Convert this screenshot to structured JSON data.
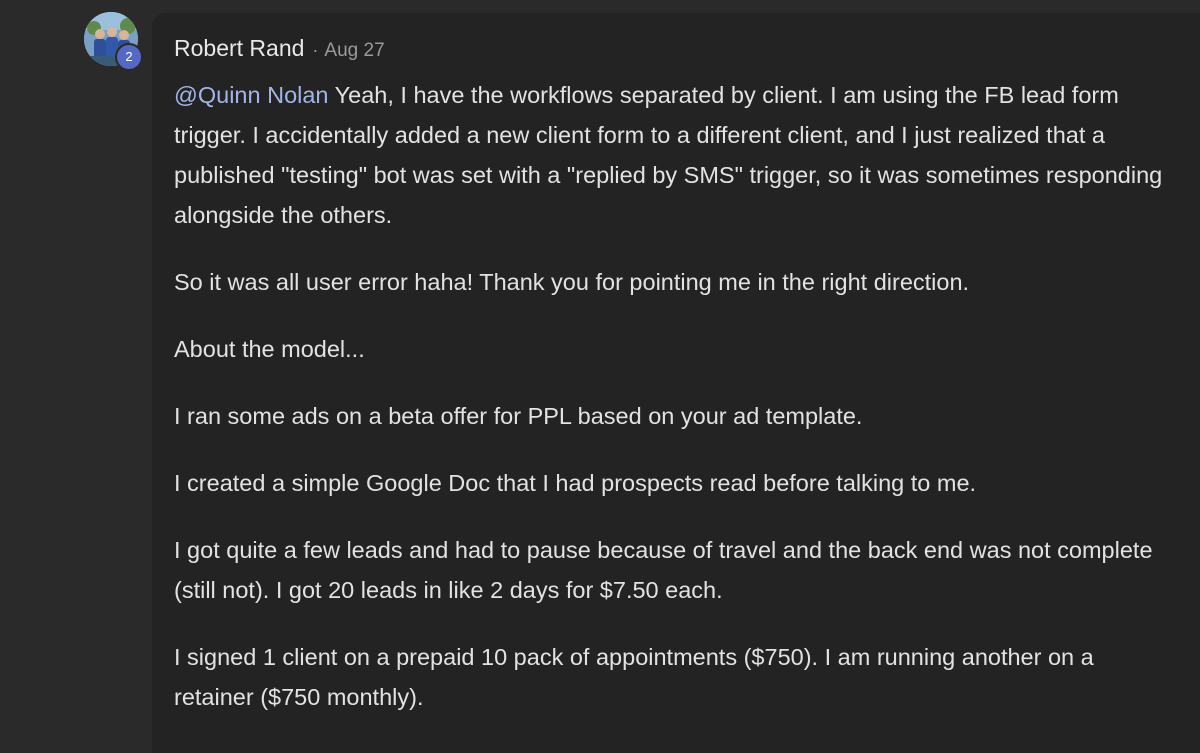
{
  "comment": {
    "author": "Robert Rand",
    "separator": "·",
    "date": "Aug 27",
    "level": "2",
    "avatar_icon": "profile-photo",
    "mention": "@Quinn Nolan",
    "paragraph_1_rest": " Yeah, I have the workflows separated by client. I am using the FB lead form trigger. I accidentally added a new client form to a different client, and I just realized that a published \"testing\" bot was set with a \"replied by SMS\" trigger, so it was sometimes responding alongside the others.",
    "paragraphs": [
      "So it was all user error haha! Thank you for pointing me in the right direction.",
      "About the model...",
      "I ran some ads on a beta offer for PPL based on your ad template.",
      "I created a simple Google Doc that I had prospects read before talking to me.",
      "I got quite a few leads and had to pause because of travel and the back end was not complete (still not). I got 20 leads in like 2 days for $7.50 each.",
      "I signed 1 client on a prepaid 10 pack of appointments ($750). I am running another on a retainer ($750 monthly)."
    ]
  },
  "colors": {
    "page_background": "#2a2a2a",
    "card_background": "#232323",
    "mention": "#a3b4e8",
    "badge": "#5468c4"
  }
}
